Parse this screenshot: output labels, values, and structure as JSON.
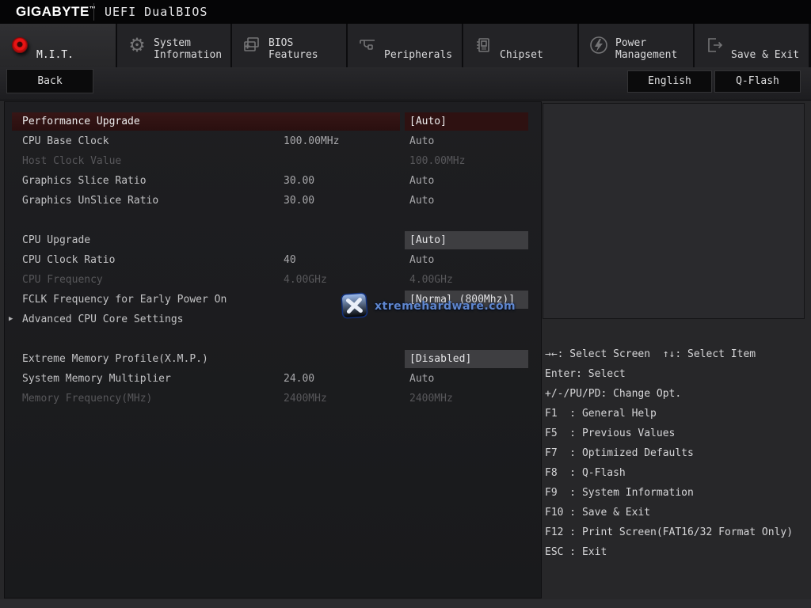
{
  "header": {
    "brand": "GIGABYTE",
    "trademark": "™",
    "title": "UEFI DualBIOS"
  },
  "tabs": [
    {
      "label": "M.I.T.",
      "icon": "mit-knob-icon",
      "active": true
    },
    {
      "label": "System Information",
      "icon": "gear-icon",
      "active": false
    },
    {
      "label": "BIOS Features",
      "icon": "windows-plus-icon",
      "active": false
    },
    {
      "label": "Peripherals",
      "icon": "peripherals-icon",
      "active": false
    },
    {
      "label": "Chipset",
      "icon": "chip-icon",
      "active": false
    },
    {
      "label": "Power Management",
      "icon": "lightning-icon",
      "active": false
    },
    {
      "label": "Save & Exit",
      "icon": "exit-door-icon",
      "active": false
    }
  ],
  "toolbar": {
    "back_label": "Back",
    "language_label": "English",
    "qflash_label": "Q-Flash"
  },
  "settings": {
    "rows": [
      {
        "label": "Performance Upgrade",
        "current": "",
        "value": "[Auto]"
      },
      {
        "label": "CPU Base Clock",
        "current": "100.00MHz",
        "value": "Auto"
      },
      {
        "label": "Host Clock Value",
        "current": "",
        "value": "100.00MHz"
      },
      {
        "label": "Graphics Slice Ratio",
        "current": "30.00",
        "value": "Auto"
      },
      {
        "label": "Graphics UnSlice Ratio",
        "current": "30.00",
        "value": "Auto"
      },
      {
        "label": "CPU Upgrade",
        "current": "",
        "value": "[Auto]"
      },
      {
        "label": "CPU Clock Ratio",
        "current": "40",
        "value": "Auto"
      },
      {
        "label": "CPU Frequency",
        "current": "4.00GHz",
        "value": "4.00GHz"
      },
      {
        "label": "FCLK Frequency for Early Power On",
        "current": "",
        "value": "[Normal (800Mhz)]"
      },
      {
        "label": "Advanced CPU Core Settings",
        "current": "",
        "value": "",
        "arrow": "▶"
      },
      {
        "label": "Extreme Memory Profile(X.M.P.)",
        "current": "",
        "value": "[Disabled]"
      },
      {
        "label": "System Memory Multiplier",
        "current": "24.00",
        "value": "Auto"
      },
      {
        "label": "Memory Frequency(MHz)",
        "current": "2400MHz",
        "value": "2400MHz"
      }
    ]
  },
  "help": {
    "lines": [
      "→←: Select Screen  ↑↓: Select Item",
      "Enter: Select",
      "+/-/PU/PD: Change Opt.",
      "F1  : General Help",
      "F5  : Previous Values",
      "F7  : Optimized Defaults",
      "F8  : Q-Flash",
      "F9  : System Information",
      "F10 : Save & Exit",
      "F12 : Print Screen(FAT16/32 Format Only)",
      "ESC : Exit"
    ]
  },
  "watermark": {
    "text": "xtremehardware.com"
  },
  "colors": {
    "highlight_row": "#2e1111",
    "value_box": "#3e3e41",
    "mit_red": "#e81414",
    "watermark_blue": "#5e86cf",
    "panel_bg": "#1b1b1e"
  }
}
